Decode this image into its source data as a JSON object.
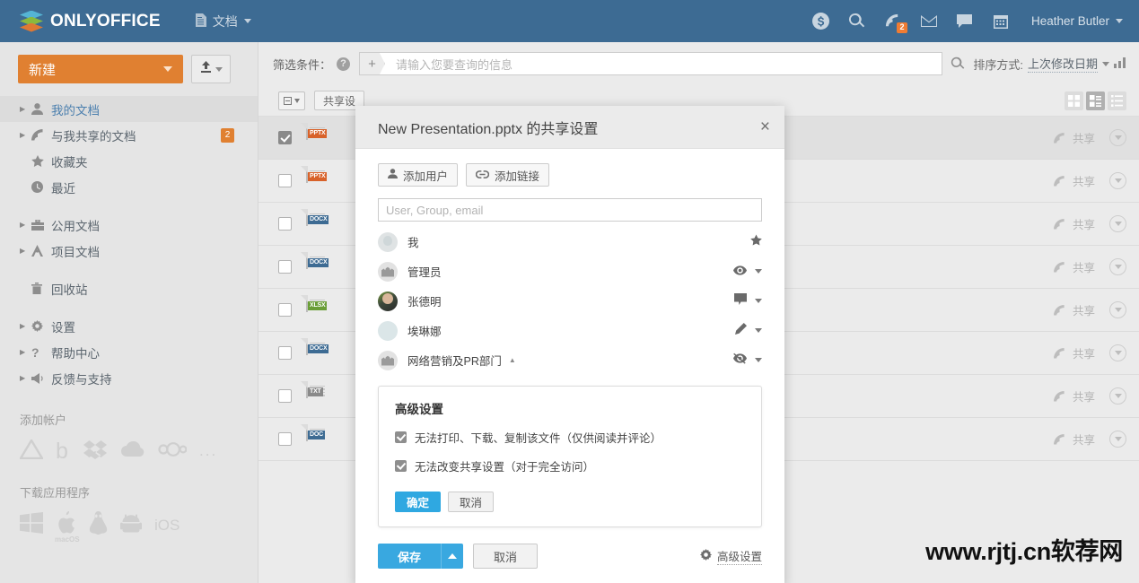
{
  "header": {
    "brand": "ONLYOFFICE",
    "module": "文档",
    "icons": [
      "dollar-icon",
      "search-icon",
      "feed-icon",
      "mail-icon",
      "chat-icon",
      "calendar-icon"
    ],
    "feed_badge": "2",
    "user": "Heather Butler"
  },
  "sidebar": {
    "new_button": "新建",
    "upload_button": "upload-icon",
    "items": [
      {
        "label": "我的文档",
        "icon": "person-icon",
        "expandable": true,
        "selected": true,
        "badge": ""
      },
      {
        "label": "与我共享的文档",
        "icon": "share-icon",
        "expandable": true,
        "selected": false,
        "badge": "2"
      },
      {
        "label": "收藏夹",
        "icon": "star-icon",
        "expandable": false,
        "selected": false,
        "badge": ""
      },
      {
        "label": "最近",
        "icon": "clock-icon",
        "expandable": false,
        "selected": false,
        "badge": ""
      },
      {
        "label": "公用文档",
        "icon": "briefcase-icon",
        "expandable": true,
        "selected": false,
        "badge": ""
      },
      {
        "label": "项目文档",
        "icon": "project-icon",
        "expandable": true,
        "selected": false,
        "badge": ""
      },
      {
        "label": "回收站",
        "icon": "trash-icon",
        "expandable": false,
        "selected": false,
        "badge": ""
      },
      {
        "label": "设置",
        "icon": "gear-icon",
        "expandable": true,
        "selected": false,
        "badge": ""
      },
      {
        "label": "帮助中心",
        "icon": "question-icon",
        "expandable": true,
        "selected": false,
        "badge": ""
      },
      {
        "label": "反馈与支持",
        "icon": "megaphone-icon",
        "expandable": true,
        "selected": false,
        "badge": ""
      }
    ],
    "accounts_title": "添加帐户",
    "accounts": [
      "google-drive-icon",
      "box-icon",
      "dropbox-icon",
      "onedrive-icon",
      "owncloud-icon",
      "more-dots-icon"
    ],
    "download_title": "下载应用程序",
    "download_apps": [
      "windows-icon",
      "macos-icon",
      "linux-icon",
      "android-icon",
      "ios-label"
    ],
    "ios_label": "iOS",
    "macos_label": "macOS"
  },
  "toolbar": {
    "filter_label": "筛选条件：",
    "filter_placeholder": "请输入您要查询的信息",
    "filter_add": "+",
    "sort_label": "排序方式:",
    "sort_value": "上次修改日期"
  },
  "table": {
    "share_settings_button": "共享设",
    "share_label": "共享",
    "rows": [
      {
        "type": "PPTX",
        "selected": true,
        "color": "#d8622a"
      },
      {
        "type": "PPTX",
        "selected": false,
        "color": "#d8622a"
      },
      {
        "type": "DOCX",
        "selected": false,
        "color": "#3d6b93"
      },
      {
        "type": "DOCX",
        "selected": false,
        "color": "#3d6b93"
      },
      {
        "type": "XLSX",
        "selected": false,
        "color": "#6a9e37"
      },
      {
        "type": "DOCX",
        "selected": false,
        "color": "#3d6b93"
      },
      {
        "type": "TXT",
        "selected": false,
        "color": "#8a8a8a"
      },
      {
        "type": "DOC",
        "selected": false,
        "color": "#3d6b93"
      }
    ],
    "view_modes": [
      "grid-view-icon",
      "tile-view-icon",
      "list-view-icon"
    ],
    "active_view": 1
  },
  "modal": {
    "title": "New Presentation.pptx 的共享设置",
    "close": "×",
    "add_user_button": "添加用户",
    "add_link_button": "添加链接",
    "user_input_placeholder": "User, Group, email",
    "users": [
      {
        "name": "我",
        "avatar": "face",
        "permission": "star-icon",
        "has_dropdown": false,
        "collapse": false
      },
      {
        "name": "管理员",
        "avatar": "group",
        "permission": "eye-icon",
        "has_dropdown": true,
        "collapse": false
      },
      {
        "name": "张德明",
        "avatar": "photo",
        "permission": "comment-icon",
        "has_dropdown": true,
        "collapse": false
      },
      {
        "name": "埃琳娜",
        "avatar": "face2",
        "permission": "pencil-icon",
        "has_dropdown": true,
        "collapse": false
      },
      {
        "name": "网络营销及PR部门",
        "avatar": "group",
        "permission": "eye-off-icon",
        "has_dropdown": true,
        "collapse": true
      }
    ],
    "advanced": {
      "title": "高级设置",
      "options": [
        {
          "label": "无法打印、下载、复制该文件（仅供阅读并评论）",
          "checked": true
        },
        {
          "label": "无法改变共享设置（对于完全访问）",
          "checked": true
        }
      ],
      "ok_button": "确定",
      "cancel_button": "取消"
    },
    "save_button": "保存",
    "cancel_button": "取消",
    "advanced_link": "高级设置"
  },
  "watermark": "www.rjtj.cn软荐网"
}
